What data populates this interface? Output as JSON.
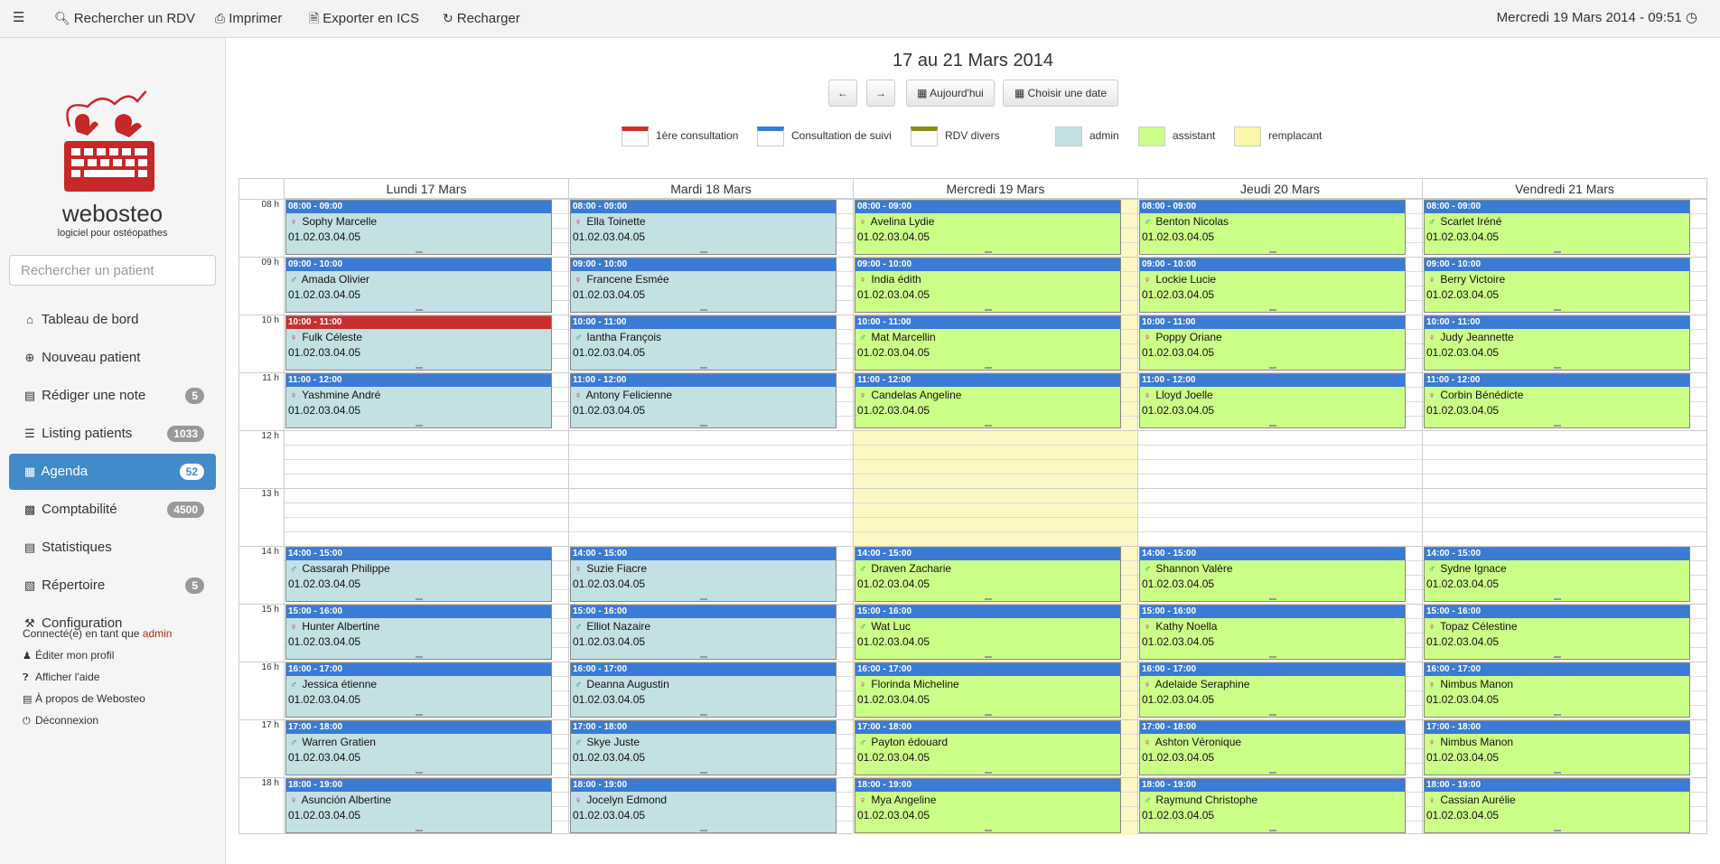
{
  "topbar": {
    "items": [
      {
        "label": "Rechercher un RDV",
        "icon": "search-icon"
      },
      {
        "label": "Imprimer",
        "icon": "print-icon"
      },
      {
        "label": "Exporter en ICS",
        "icon": "file-icon"
      },
      {
        "label": "Recharger",
        "icon": "refresh-icon"
      }
    ],
    "datetime": "Mercredi 19 Mars 2014 - 09:51"
  },
  "logo": {
    "name": "webosteo",
    "tagline": "logiciel pour ostéopathes"
  },
  "search": {
    "placeholder": "Rechercher un patient"
  },
  "nav": [
    {
      "label": "Tableau de bord",
      "icon": "home-icon",
      "badge": null,
      "active": false
    },
    {
      "label": "Nouveau patient",
      "icon": "plus-circle-icon",
      "badge": null,
      "active": false
    },
    {
      "label": "Rédiger une note",
      "icon": "note-icon",
      "badge": "5",
      "active": false
    },
    {
      "label": "Listing patients",
      "icon": "list-icon",
      "badge": "1033",
      "active": false
    },
    {
      "label": "Agenda",
      "icon": "calendar-icon",
      "badge": "52",
      "active": true
    },
    {
      "label": "Comptabilité",
      "icon": "calculator-icon",
      "badge": "4500",
      "active": false
    },
    {
      "label": "Statistiques",
      "icon": "bar-chart-icon",
      "badge": null,
      "active": false
    },
    {
      "label": "Répertoire",
      "icon": "book-icon",
      "badge": "5",
      "active": false
    },
    {
      "label": "Configuration",
      "icon": "wrench-icon",
      "badge": null,
      "active": false
    }
  ],
  "user": {
    "connected_prefix": "Connecté(e) en tant que",
    "username": "admin",
    "links": [
      {
        "label": "Éditer mon profil",
        "icon": "user-icon"
      },
      {
        "label": "Afficher l'aide",
        "icon": "question-icon"
      },
      {
        "label": "À propos de Webosteo",
        "icon": "info-icon"
      },
      {
        "label": "Déconnexion",
        "icon": "power-icon"
      }
    ]
  },
  "agenda": {
    "title": "17 au 21 Mars 2014",
    "buttons": {
      "prev": "←",
      "next": "→",
      "today": "Aujourd'hui",
      "choose": "Choisir une date"
    },
    "legend": [
      {
        "label": "1ère consultation",
        "color": "#c9302c",
        "type": "bar"
      },
      {
        "label": "Consultation de suivi",
        "color": "#3a7bd5",
        "type": "bar"
      },
      {
        "label": "RDV divers",
        "color": "#8a8a1e",
        "type": "bar"
      },
      {
        "label": "admin",
        "color": "#c3e0e3",
        "type": "fill"
      },
      {
        "label": "assistant",
        "color": "#ccff88",
        "type": "fill"
      },
      {
        "label": "remplacant",
        "color": "#faf7a8",
        "type": "fill"
      }
    ],
    "hours": [
      "08 h",
      "09 h",
      "10 h",
      "11 h",
      "12 h",
      "13 h",
      "14 h",
      "15 h",
      "16 h",
      "17 h",
      "18 h"
    ],
    "days": [
      {
        "label": "Lundi 17 Mars",
        "color": "#c3e0e3",
        "events": [
          {
            "time": "08:00 - 09:00",
            "gender": "f",
            "name": "Sophy Marcelle",
            "phone": "01.02.03.04.05",
            "hour": 8
          },
          {
            "time": "09:00 - 10:00",
            "gender": "m",
            "name": "Amada Olivier",
            "phone": "01.02.03.04.05",
            "hour": 9
          },
          {
            "time": "10:00 - 11:00",
            "gender": "f",
            "name": "Fulk Céleste",
            "phone": "01.02.03.04.05",
            "hour": 10,
            "first": true
          },
          {
            "time": "11:00 - 12:00",
            "gender": "f",
            "name": "Yashmine André",
            "phone": "01.02.03.04.05",
            "hour": 11
          },
          {
            "time": "14:00 - 15:00",
            "gender": "m",
            "name": "Cassarah Philippe",
            "phone": "01.02.03.04.05",
            "hour": 14
          },
          {
            "time": "15:00 - 16:00",
            "gender": "f",
            "name": "Hunter Albertine",
            "phone": "01.02.03.04.05",
            "hour": 15
          },
          {
            "time": "16:00 - 17:00",
            "gender": "m",
            "name": "Jessica étienne",
            "phone": "01.02.03.04.05",
            "hour": 16
          },
          {
            "time": "17:00 - 18:00",
            "gender": "m",
            "name": "Warren Gratien",
            "phone": "01.02.03.04.05",
            "hour": 17
          },
          {
            "time": "18:00 - 19:00",
            "gender": "f",
            "name": "Asunción Albertine",
            "phone": "01.02.03.04.05",
            "hour": 18
          }
        ]
      },
      {
        "label": "Mardi 18 Mars",
        "color": "#c3e0e3",
        "events": [
          {
            "time": "08:00 - 09:00",
            "gender": "f",
            "name": "Ella Toinette",
            "phone": "01.02.03.04.05",
            "hour": 8
          },
          {
            "time": "09:00 - 10:00",
            "gender": "f",
            "name": "Francene Esmée",
            "phone": "01.02.03.04.05",
            "hour": 9
          },
          {
            "time": "10:00 - 11:00",
            "gender": "m",
            "name": "Iantha François",
            "phone": "01.02.03.04.05",
            "hour": 10
          },
          {
            "time": "11:00 - 12:00",
            "gender": "f",
            "name": "Antony Felicienne",
            "phone": "01.02.03.04.05",
            "hour": 11
          },
          {
            "time": "14:00 - 15:00",
            "gender": "f",
            "name": "Suzie Fiacre",
            "phone": "01.02.03.04.05",
            "hour": 14
          },
          {
            "time": "15:00 - 16:00",
            "gender": "m",
            "name": "Elliot Nazaire",
            "phone": "01.02.03.04.05",
            "hour": 15
          },
          {
            "time": "16:00 - 17:00",
            "gender": "m",
            "name": "Deanna Augustin",
            "phone": "01.02.03.04.05",
            "hour": 16
          },
          {
            "time": "17:00 - 18:00",
            "gender": "m",
            "name": "Skye Juste",
            "phone": "01.02.03.04.05",
            "hour": 17
          },
          {
            "time": "18:00 - 19:00",
            "gender": "f",
            "name": "Jocelyn Edmond",
            "phone": "01.02.03.04.05",
            "hour": 18
          }
        ]
      },
      {
        "label": "Mercredi 19 Mars",
        "color": "#ccff88",
        "today": true,
        "events": [
          {
            "time": "08:00 - 09:00",
            "gender": "f",
            "name": "Avelina Lydie",
            "phone": "01.02.03.04.05",
            "hour": 8
          },
          {
            "time": "09:00 - 10:00",
            "gender": "f",
            "name": "India édith",
            "phone": "01.02.03.04.05",
            "hour": 9
          },
          {
            "time": "10:00 - 11:00",
            "gender": "m",
            "name": "Mat Marcellin",
            "phone": "01.02.03.04.05",
            "hour": 10
          },
          {
            "time": "11:00 - 12:00",
            "gender": "f",
            "name": "Candelas Angeline",
            "phone": "01.02.03.04.05",
            "hour": 11
          },
          {
            "time": "14:00 - 15:00",
            "gender": "m",
            "name": "Draven Zacharie",
            "phone": "01.02.03.04.05",
            "hour": 14
          },
          {
            "time": "15:00 - 16:00",
            "gender": "m",
            "name": "Wat Luc",
            "phone": "01.02.03.04.05",
            "hour": 15
          },
          {
            "time": "16:00 - 17:00",
            "gender": "f",
            "name": "Florinda Micheline",
            "phone": "01.02.03.04.05",
            "hour": 16
          },
          {
            "time": "17:00 - 18:00",
            "gender": "m",
            "name": "Payton édouard",
            "phone": "01.02.03.04.05",
            "hour": 17
          },
          {
            "time": "18:00 - 19:00",
            "gender": "f",
            "name": "Mya Angeline",
            "phone": "01.02.03.04.05",
            "hour": 18
          }
        ]
      },
      {
        "label": "Jeudi 20 Mars",
        "color": "#ccff88",
        "events": [
          {
            "time": "08:00 - 09:00",
            "gender": "m",
            "name": "Benton Nicolas",
            "phone": "01.02.03.04.05",
            "hour": 8
          },
          {
            "time": "09:00 - 10:00",
            "gender": "f",
            "name": "Lockie Lucie",
            "phone": "01.02.03.04.05",
            "hour": 9
          },
          {
            "time": "10:00 - 11:00",
            "gender": "f",
            "name": "Poppy Oriane",
            "phone": "01.02.03.04.05",
            "hour": 10
          },
          {
            "time": "11:00 - 12:00",
            "gender": "f",
            "name": "Lloyd Joelle",
            "phone": "01.02.03.04.05",
            "hour": 11
          },
          {
            "time": "14:00 - 15:00",
            "gender": "m",
            "name": "Shannon Valère",
            "phone": "01.02.03.04.05",
            "hour": 14
          },
          {
            "time": "15:00 - 16:00",
            "gender": "f",
            "name": "Kathy Noella",
            "phone": "01.02.03.04.05",
            "hour": 15
          },
          {
            "time": "16:00 - 17:00",
            "gender": "f",
            "name": "Adelaide Seraphine",
            "phone": "01.02.03.04.05",
            "hour": 16
          },
          {
            "time": "17:00 - 18:00",
            "gender": "f",
            "name": "Ashton Véronique",
            "phone": "01.02.03.04.05",
            "hour": 17
          },
          {
            "time": "18:00 - 19:00",
            "gender": "m",
            "name": "Raymund Christophe",
            "phone": "01.02.03.04.05",
            "hour": 18
          }
        ]
      },
      {
        "label": "Vendredi 21 Mars",
        "color": "#ccff88",
        "events": [
          {
            "time": "08:00 - 09:00",
            "gender": "m",
            "name": "Scarlet Iréné",
            "phone": "01.02.03.04.05",
            "hour": 8
          },
          {
            "time": "09:00 - 10:00",
            "gender": "f",
            "name": "Berry Victoire",
            "phone": "01.02.03.04.05",
            "hour": 9
          },
          {
            "time": "10:00 - 11:00",
            "gender": "f",
            "name": "Judy Jeannette",
            "phone": "01.02.03.04.05",
            "hour": 10
          },
          {
            "time": "11:00 - 12:00",
            "gender": "f",
            "name": "Corbin Bénédicte",
            "phone": "01.02.03.04.05",
            "hour": 11
          },
          {
            "time": "14:00 - 15:00",
            "gender": "m",
            "name": "Sydne Ignace",
            "phone": "01.02.03.04.05",
            "hour": 14
          },
          {
            "time": "15:00 - 16:00",
            "gender": "f",
            "name": "Topaz Célestine",
            "phone": "01.02.03.04.05",
            "hour": 15
          },
          {
            "time": "16:00 - 17:00",
            "gender": "f",
            "name": "Nimbus Manon",
            "phone": "01.02.03.04.05",
            "hour": 16
          },
          {
            "time": "17:00 - 18:00",
            "gender": "f",
            "name": "Nimbus Manon",
            "phone": "01.02.03.04.05",
            "hour": 17
          },
          {
            "time": "18:00 - 19:00",
            "gender": "f",
            "name": "Cassian Aurélie",
            "phone": "01.02.03.04.05",
            "hour": 18
          }
        ]
      }
    ]
  }
}
